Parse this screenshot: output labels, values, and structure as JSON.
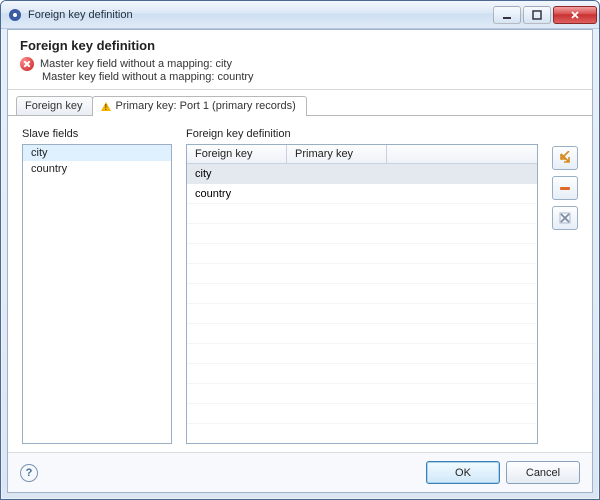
{
  "window": {
    "title": "Foreign key definition"
  },
  "header": {
    "heading": "Foreign key definition",
    "messages": [
      "Master key field without a mapping: city",
      "Master key field without a mapping: country"
    ]
  },
  "tabs": [
    {
      "label": "Foreign key"
    },
    {
      "label": "Primary key: Port 1 (primary records)"
    }
  ],
  "slave": {
    "label": "Slave fields",
    "items": [
      "city",
      "country"
    ]
  },
  "defpanel": {
    "label": "Foreign key definition",
    "columns": {
      "fk": "Foreign key",
      "pk": "Primary key"
    },
    "rows": [
      {
        "fk": "city",
        "pk": ""
      },
      {
        "fk": "country",
        "pk": ""
      }
    ]
  },
  "footer": {
    "ok": "OK",
    "cancel": "Cancel"
  }
}
